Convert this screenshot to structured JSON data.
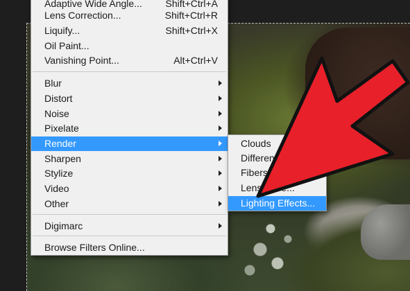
{
  "filter_menu": {
    "items": [
      {
        "label": "Adaptive Wide Angle...",
        "shortcut": "Shift+Ctrl+A"
      },
      {
        "label": "Lens Correction...",
        "shortcut": "Shift+Ctrl+R"
      },
      {
        "label": "Liquify...",
        "shortcut": "Shift+Ctrl+X"
      },
      {
        "label": "Oil Paint...",
        "shortcut": ""
      },
      {
        "label": "Vanishing Point...",
        "shortcut": "Alt+Ctrl+V"
      },
      {
        "label": "Blur",
        "submenu": true
      },
      {
        "label": "Distort",
        "submenu": true
      },
      {
        "label": "Noise",
        "submenu": true
      },
      {
        "label": "Pixelate",
        "submenu": true
      },
      {
        "label": "Render",
        "submenu": true,
        "selected": true
      },
      {
        "label": "Sharpen",
        "submenu": true
      },
      {
        "label": "Stylize",
        "submenu": true
      },
      {
        "label": "Video",
        "submenu": true
      },
      {
        "label": "Other",
        "submenu": true
      },
      {
        "label": "Digimarc",
        "submenu": true
      },
      {
        "label": "Browse Filters Online..."
      }
    ]
  },
  "render_submenu": {
    "items": [
      {
        "label": "Clouds"
      },
      {
        "label": "Difference Clouds"
      },
      {
        "label": "Fibers..."
      },
      {
        "label": "Lens Flare..."
      },
      {
        "label": "Lighting Effects...",
        "selected": true
      }
    ]
  },
  "colors": {
    "selection": "#3399ff",
    "menu_bg": "#f0f0f0",
    "arrow_red": "#e8202a"
  },
  "icons": {
    "submenu_arrow": "chevron-right-icon",
    "overlay": "red-pointer-arrow"
  }
}
